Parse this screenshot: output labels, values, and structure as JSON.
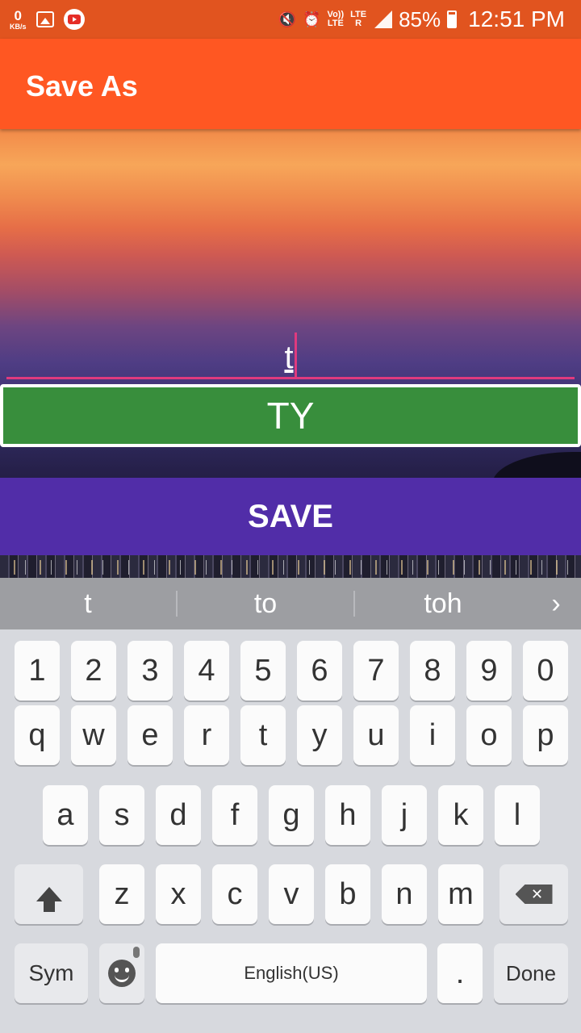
{
  "status_bar": {
    "net_speed_value": "0",
    "net_speed_unit": "KB/s",
    "gallery_icon": "image-icon",
    "youtube_icon": "youtube-icon",
    "mute_icon": "vibrate-mute-icon",
    "alarm_icon": "alarm-icon",
    "volte_top": "Vo))",
    "volte_bottom": "LTE",
    "lte_label": "LTE",
    "roaming": "R",
    "battery_percent": "85%",
    "battery_level": 0.85,
    "time": "12:51 PM"
  },
  "app_bar": {
    "title": "Save As"
  },
  "text_field": {
    "value": "t"
  },
  "result_bar": {
    "text": "TY",
    "color": "#388e3c"
  },
  "save_button": {
    "label": "SAVE",
    "color": "#512da8"
  },
  "suggestions": {
    "items": [
      "t",
      "to",
      "toh"
    ],
    "more_icon": "chevron-right-icon"
  },
  "keyboard": {
    "number_row": [
      "1",
      "2",
      "3",
      "4",
      "5",
      "6",
      "7",
      "8",
      "9",
      "0"
    ],
    "row1": [
      "q",
      "w",
      "e",
      "r",
      "t",
      "y",
      "u",
      "i",
      "o",
      "p"
    ],
    "row2": [
      "a",
      "s",
      "d",
      "f",
      "g",
      "h",
      "j",
      "k",
      "l"
    ],
    "row3": [
      "z",
      "x",
      "c",
      "v",
      "b",
      "n",
      "m"
    ],
    "shift_icon": "shift-icon",
    "backspace_icon": "backspace-icon",
    "sym_label": "Sym",
    "emoji_icon": "emoji-icon",
    "space_label": "English(US)",
    "period_label": ".",
    "done_label": "Done"
  },
  "colors": {
    "status_bar": "#e1541f",
    "app_bar": "#ff5722",
    "accent": "#e03a7e"
  }
}
